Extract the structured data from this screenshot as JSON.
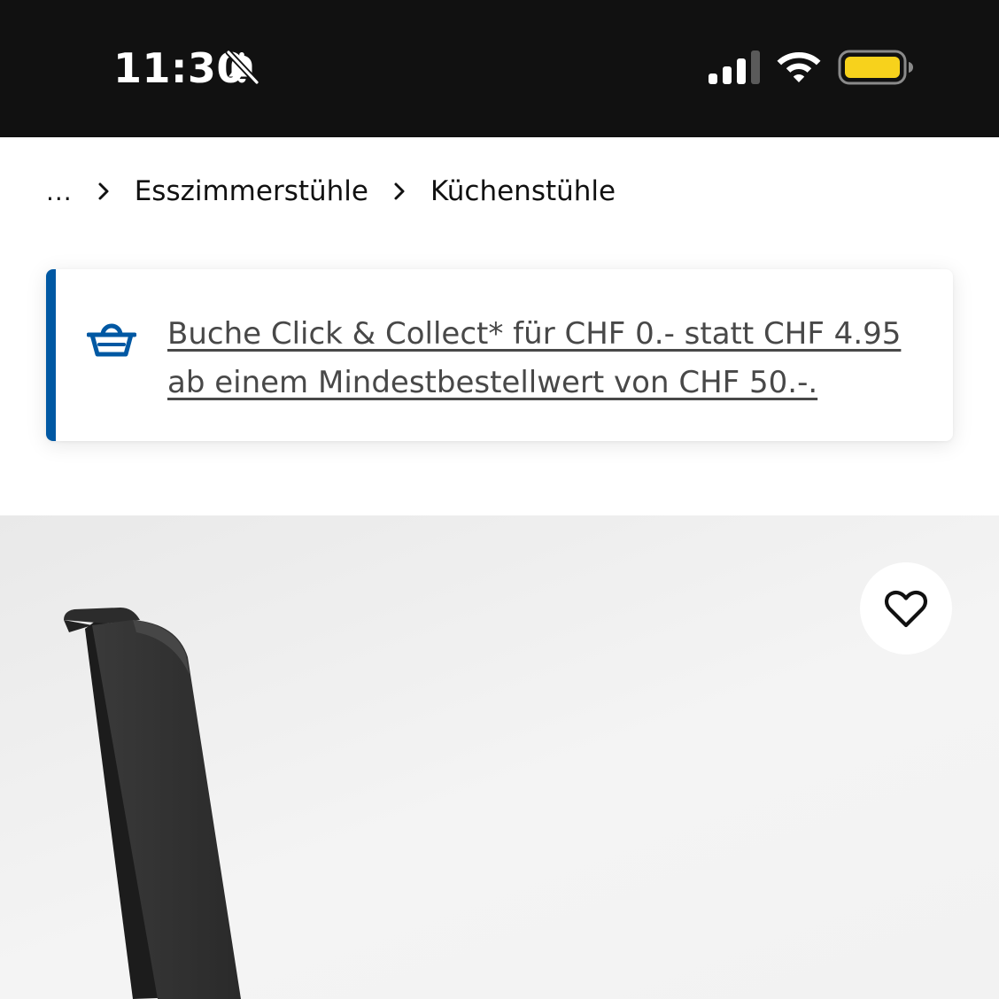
{
  "status_bar": {
    "time": "11:30",
    "icons": [
      "bell-slash-icon",
      "signal-icon",
      "wifi-icon",
      "battery-icon"
    ],
    "battery_color": "#f7d21c"
  },
  "breadcrumb": {
    "ellipsis": "...",
    "items": [
      "Esszimmerstühle",
      "Küchenstühle"
    ]
  },
  "promo": {
    "icon": "basket-icon",
    "text": "Buche Click & Collect* für CHF 0.- statt CHF 4.95 ab einem Mindestbestellwert von CHF 50.-.",
    "accent_color": "#0058a3"
  },
  "product": {
    "image": "chair-photo",
    "favorite_icon": "heart-icon"
  }
}
